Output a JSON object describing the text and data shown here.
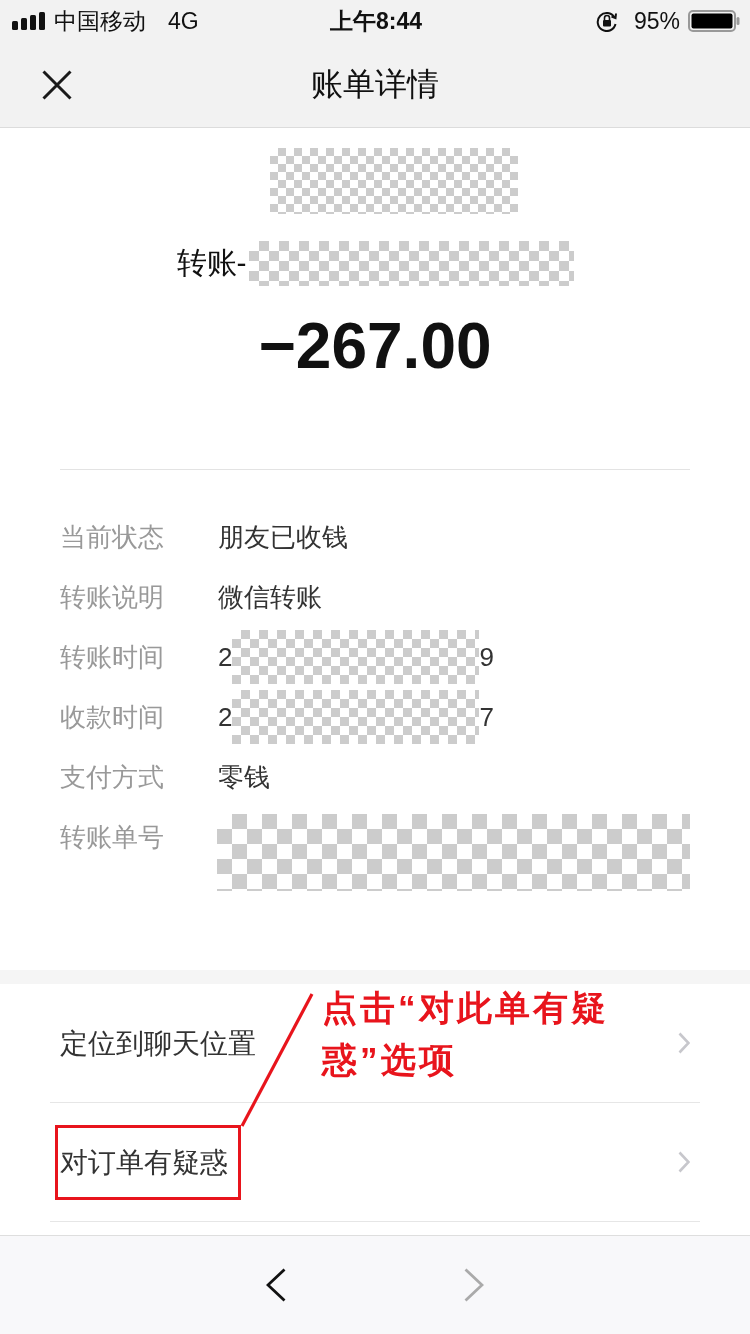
{
  "status_bar": {
    "carrier": "中国移动",
    "network": "4G",
    "time": "上午8:44",
    "battery": "95%"
  },
  "nav": {
    "title": "账单详情"
  },
  "summary": {
    "image_masked": true,
    "payee": "转账-",
    "payee_masked": true,
    "amount": "−267.00"
  },
  "details": [
    {
      "label": "当前状态",
      "kind": "text",
      "value": "朋友已收钱"
    },
    {
      "label": "转账说明",
      "kind": "text",
      "value": "微信转账"
    },
    {
      "label": "转账时间",
      "kind": "masked",
      "value_start": "2",
      "value_end": "9"
    },
    {
      "label": "收款时间",
      "kind": "masked",
      "value_start": "2",
      "value_end": "7"
    },
    {
      "label": "支付方式",
      "kind": "text",
      "value": "零钱"
    },
    {
      "label": "转账单号",
      "kind": "masked_block"
    }
  ],
  "actions": [
    {
      "label": "定位到聊天位置",
      "highlighted": false
    },
    {
      "label": "对订单有疑惑",
      "highlighted": true
    }
  ],
  "annotation": {
    "text": "点击“对此单有疑惑”选项"
  },
  "toolbar": [
    {
      "kind": "back",
      "disabled": false
    },
    {
      "kind": "forward",
      "disabled": true
    }
  ]
}
